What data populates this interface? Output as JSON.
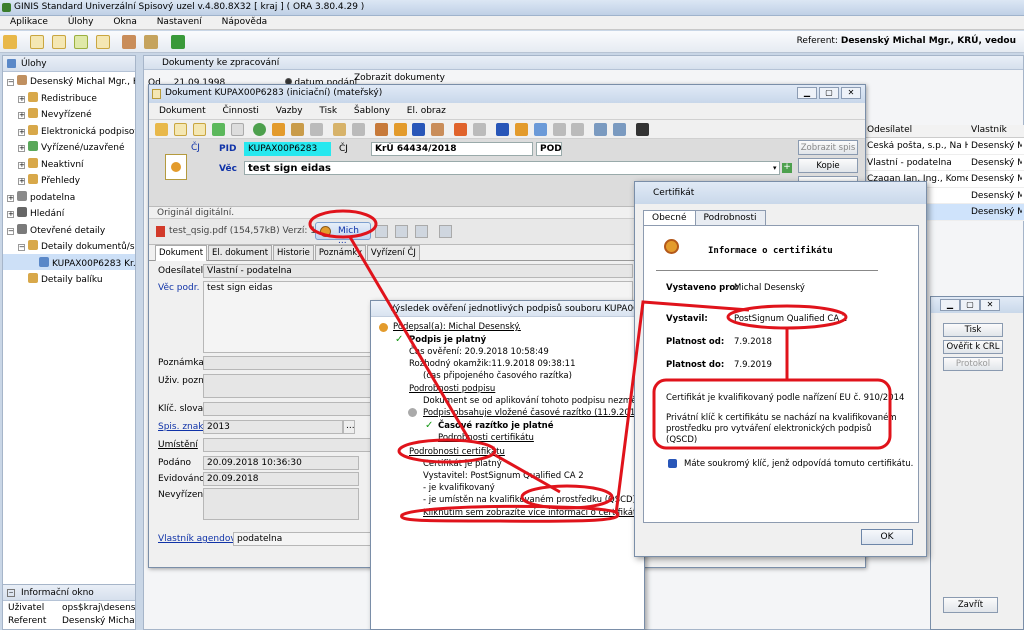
{
  "app": {
    "title": "GINIS Standard Univerzální Spisový uzel v.4.80.8X32 [ kraj ] ( ORA 3.80.4.29 )",
    "menu": [
      "Aplikace",
      "Úlohy",
      "Okna",
      "Nastavení",
      "Nápověda"
    ],
    "referent_label": "Referent:",
    "referent_value": "Desenský Michal Mgr., KRÚ, vedou"
  },
  "left_panel": {
    "title": "Úlohy",
    "tree": [
      {
        "label": "Desenský Michal Mgr., K...",
        "indent": 0,
        "expander": "⊟"
      },
      {
        "label": "Redistribuce",
        "indent": 1,
        "expander": "⊞"
      },
      {
        "label": "Nevyřízené",
        "indent": 1,
        "expander": "⊞"
      },
      {
        "label": "Elektronická podpisov...",
        "indent": 1,
        "expander": "⊞"
      },
      {
        "label": "Vyřízené/uzavřené",
        "indent": 1,
        "expander": "⊞"
      },
      {
        "label": "Neaktivní",
        "indent": 1,
        "expander": "⊞"
      },
      {
        "label": "Přehledy",
        "indent": 1,
        "expander": "⊞"
      },
      {
        "label": "podatelna",
        "indent": 0,
        "expander": "⊞"
      },
      {
        "label": "Hledání",
        "indent": 0,
        "expander": "⊞"
      },
      {
        "label": "Otevřené detaily",
        "indent": 0,
        "expander": "⊟"
      },
      {
        "label": "Detaily dokumentů/s...",
        "indent": 1,
        "expander": "⊟"
      },
      {
        "label": "KUPAX00P6283 Kr...",
        "indent": 2,
        "expander": ""
      },
      {
        "label": "Detaily balíku",
        "indent": 1,
        "expander": ""
      }
    ],
    "info_title": "Informační okno",
    "info_rows": [
      {
        "label": "Uživatel",
        "value": "ops$kraj\\desensky"
      },
      {
        "label": "Referent",
        "value": "Desenský Michal ..."
      }
    ]
  },
  "docs_window": {
    "title": "Dokumenty ke zpracování",
    "filter_od": "Od",
    "filter_date": "21.09.1998",
    "radio_label": "datum podání",
    "show_button": "Zobrazit dokumenty",
    "columns": [
      "Odesílatel",
      "Vlastník"
    ],
    "rows": [
      [
        "Česká pošta, s.p., Na Hrá...",
        "Desenský Mich"
      ],
      [
        "Vlastní - podatelna",
        "Desenský Mich"
      ],
      [
        "Czagan Jan, Ing., Komen...",
        "Desenský Mich"
      ],
      [
        "...na",
        "Desenský Mich"
      ],
      [
        "...na",
        "Desenský Mich"
      ]
    ]
  },
  "doc_window": {
    "title": "Dokument KUPAX00P6283 (iniciační) (mateřský)",
    "menu": [
      "Dokument",
      "Činnosti",
      "Vazby",
      "Tisk",
      "Šablony",
      "El. obraz"
    ],
    "cj_label": "ČJ",
    "pid_label": "PID",
    "pid_value": "KUPAX00P6283",
    "cj2_label": "ČJ",
    "cj_value": "KrÚ  64434/2018",
    "pod_value": "POD",
    "vec_label": "Věc",
    "vec_value": "test sign eidas",
    "btn_zobrazit": "Zobrazit spis",
    "btn_kopie": "Kopie",
    "original": "Originál digitální.",
    "file_name": "test_qsig.pdf (154,57kB) Verzí: 1",
    "sign_button": "Mich ...",
    "tabs": [
      "Dokument",
      "El. dokument",
      "Historie",
      "Poznámky",
      "Vyřízení ČJ"
    ],
    "fields": {
      "odesilatel_label": "Odesílatel",
      "odesilatel_value": "Vlastní - podatelna",
      "vec_podr_label": "Věc podr.",
      "vec_podr_value": "test sign eidas",
      "poznamka_label": "Poznámka",
      "uziv_label": "Uživ. pozn.",
      "klic_label": "Klíč. slova",
      "spis_label": "Spis. znak",
      "spis_value": "2013",
      "umisteni_label": "Umístění",
      "podano_label": "Podáno",
      "podano_value": "20.09.2018 10:36:30",
      "evidovano_label": "Evidováno",
      "evidovano_value": "20.09.2018",
      "nevyrizen_label": "Nevyřízen",
      "vlastnik_label": "Vlastník agendový",
      "vlastnik_value": "podatelna"
    }
  },
  "verify_window": {
    "title": "Výsledek ověření jednotlivých podpisů souboru KUPA0C1CEIYC",
    "lines": [
      {
        "text": "Podepsal(a): Michal Desenský.",
        "style": "u"
      },
      {
        "text": "Podpis je platný",
        "style": "b"
      },
      {
        "text": "Čas ověření: 20.9.2018 10:58:49",
        "style": ""
      },
      {
        "text": "Rozhodný okamžik:11.9.2018 09:38:11",
        "style": ""
      },
      {
        "text": "(čas připojeného časového razítka)",
        "style": ""
      },
      {
        "text": "Podrobnosti podpisu",
        "style": "u"
      },
      {
        "text": "Dokument se od aplikování tohoto podpisu nezměnil",
        "style": ""
      },
      {
        "text": "Podpis obsahuje vložené časové razítko (11.9.2018 09:38:11)",
        "style": "u"
      },
      {
        "text": "Časové razítko je platné",
        "style": "b"
      },
      {
        "text": "Podrobnosti certifikátu",
        "style": "u"
      },
      {
        "text": "Podrobnosti certifikátu",
        "style": "u"
      },
      {
        "text": "Certifikát je platný",
        "style": ""
      },
      {
        "text": "Vystavitel: PostSignum Qualified CA 2",
        "style": ""
      },
      {
        "text": "- je kvalifikovaný",
        "style": ""
      },
      {
        "text": "- je umístěn na kvalifikovaném prostředku (QSCD)",
        "style": ""
      },
      {
        "text": "Kliknutím sem zobrazíte více informací o certifikátu",
        "style": "u"
      }
    ]
  },
  "cert_dialog": {
    "title": "Certifikát",
    "tabs": [
      "Obecné",
      "Podrobnosti"
    ],
    "header": "Informace o certifikátu",
    "issued_to_label": "Vystaveno pro:",
    "issued_to_value": "Michal Desenský",
    "issuer_label": "Vystavil:",
    "issuer_value": "PostSignum Qualified CA 2",
    "valid_from_label": "Platnost od:",
    "valid_from_value": "7.9.2018",
    "valid_to_label": "Platnost do:",
    "valid_to_value": "7.9.2019",
    "qualified_text": "Certifikát je kvalifikovaný podle nařízení EU č. 910/2014",
    "private_key_line1": "Privátní klíč k certifikátu se nachází na kvalifikovaném",
    "private_key_line2": "prostředku pro vytváření elektronických podpisů",
    "private_key_line3": "(QSCD)",
    "private_key_note": "Máte soukromý klíč, jenž odpovídá tomuto certifikátu.",
    "ok_button": "OK"
  },
  "right_dialog": {
    "buttons": [
      "Tisk",
      "Ověřit k CRL",
      "Protokol"
    ],
    "close_button": "Zavřít"
  },
  "colors": {
    "annotation": "#e0131b",
    "link": "#1033a8",
    "pid_highlight": "#26e8ef",
    "selection": "#cde0f7"
  }
}
